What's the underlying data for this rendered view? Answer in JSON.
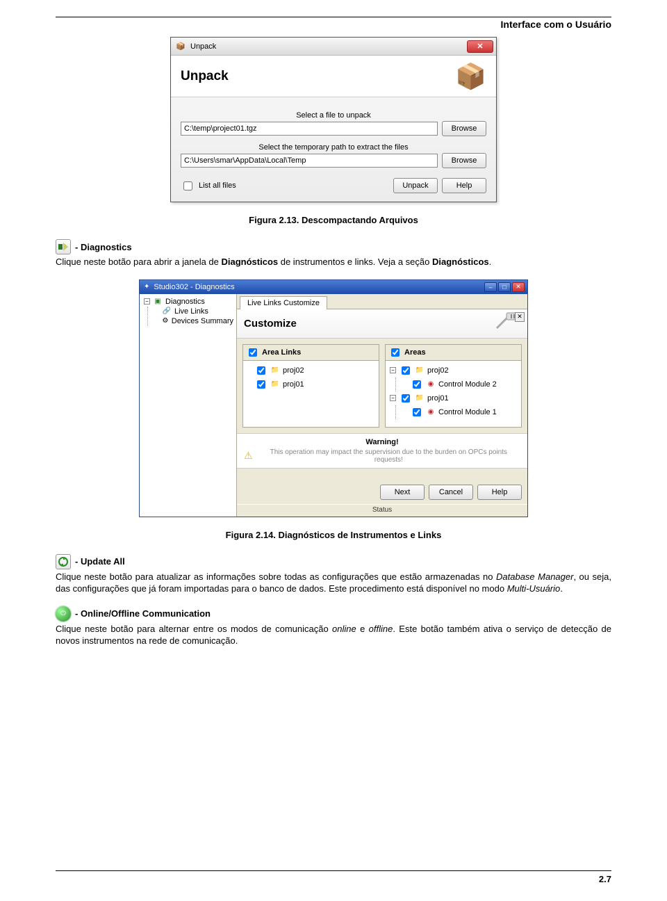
{
  "page_header": "Interface com o Usuário",
  "page_number": "2.7",
  "unpack": {
    "titlebar": "Unpack",
    "banner_title": "Unpack",
    "label_file": "Select a file to unpack",
    "file_value": "C:\\temp\\project01.tgz",
    "label_path": "Select the temporary path to extract the files",
    "path_value": "C:\\Users\\smar\\AppData\\Local\\Temp",
    "browse": "Browse",
    "list_all": "List all files",
    "unpack_btn": "Unpack",
    "help_btn": "Help"
  },
  "fig213": "Figura 2.13. Descompactando Arquivos",
  "diag_tool": {
    "name": " - Diagnostics",
    "text_a": "Clique neste botão para abrir a janela de ",
    "bold_a": "Diagnósticos",
    "text_b": " de instrumentos e links. Veja a seção ",
    "bold_b": "Diagnósticos",
    "text_c": "."
  },
  "studio": {
    "titlebar": "Studio302 - Diagnostics",
    "tree": {
      "root": "Diagnostics",
      "live_links": "Live Links",
      "dev_summary": "Devices Summary"
    },
    "tab": "Live Links Customize",
    "customize": "Customize",
    "area_links": "Area Links",
    "areas": "Areas",
    "proj01": "proj01",
    "proj02": "proj02",
    "cm1": "Control Module 1",
    "cm2": "Control Module 2",
    "warning": "Warning!",
    "warning_text": "This operation may impact the supervision due to the burden on OPCs points requests!",
    "next": "Next",
    "cancel": "Cancel",
    "help": "Help",
    "status": "Status"
  },
  "fig214": "Figura 2.14. Diagnósticos de Instrumentos e Links",
  "update_tool": {
    "name": " - Update All",
    "text_a": "Clique neste botão para atualizar as informações sobre todas as configurações que estão armazenadas no ",
    "italic_a": "Database Manager",
    "text_b": ", ou seja, das configurações que já foram importadas para o banco de dados. Este procedimento está disponível no modo ",
    "italic_b": "Multi-Usuário",
    "text_c": "."
  },
  "online_tool": {
    "name": " - Online/Offline Communication",
    "text_a": "Clique neste botão para alternar entre os modos de comunicação ",
    "italic_a": "online",
    "text_b": " e ",
    "italic_b": "offline",
    "text_c": ". Este botão também ativa o serviço de detecção de novos instrumentos na rede de comunicação."
  }
}
